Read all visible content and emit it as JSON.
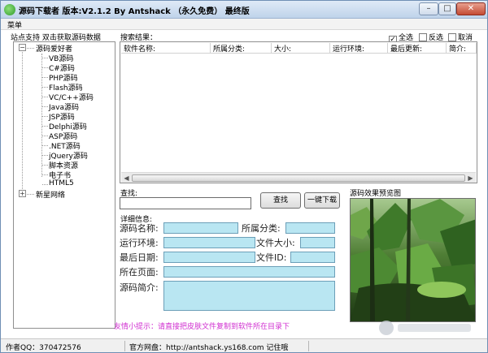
{
  "window": {
    "title": "源码下载者 版本:V2.1.2 By Antshack （永久免费） 最终版",
    "buttons": {
      "minimize": "–",
      "maximize": "□",
      "close": "✕"
    }
  },
  "menu": {
    "label": "菜单"
  },
  "left_panel": {
    "header": "站点支持 双击获取源码数据",
    "tree": {
      "root1": {
        "label": "源码爱好者",
        "expander": "−"
      },
      "items": [
        "VB源码",
        "C#源码",
        "PHP源码",
        "Flash源码",
        "VC/C++源码",
        "Java源码",
        "JSP源码",
        "Delphi源码",
        "ASP源码",
        ".NET源码",
        "jQuery源码",
        "脚本资源",
        "电子书",
        "HTML5"
      ],
      "root2": {
        "label": "新星网络",
        "expander": "+"
      }
    }
  },
  "results": {
    "label": "搜索结果：",
    "checks": [
      {
        "label": "全选",
        "checked": true
      },
      {
        "label": "反选",
        "checked": false
      },
      {
        "label": "取消",
        "checked": false
      }
    ],
    "columns": [
      "软件名称:",
      "所属分类:",
      "大小:",
      "运行环境:",
      "最后更新:",
      "简介:"
    ],
    "scroll": {
      "left": "◀",
      "right": "▶"
    }
  },
  "search": {
    "label": "查找:",
    "value": "",
    "search_button": "查找",
    "download_button": "一键下载"
  },
  "details": {
    "label": "详细信息:",
    "name_label": "源码名称:",
    "category_label": "所属分类:",
    "env_label": "运行环境:",
    "size_label": "文件大小:",
    "updated_label": "最后日期:",
    "fileid_label": "文件ID:",
    "page_label": "所在页面:",
    "intro_label": "源码简介:"
  },
  "preview": {
    "label": "源码效果预览图"
  },
  "tip": "友情小提示：请直接把皮肤文件复制到软件所在目录下",
  "status": {
    "author": "作者QQ：370472576",
    "website": "官方网盘：http://antshack.ys168.com 记住哦"
  },
  "colors": {
    "field_bg": "#b9e6f2",
    "tip": "#d02fd0",
    "title_bar": "#cfdff1"
  }
}
